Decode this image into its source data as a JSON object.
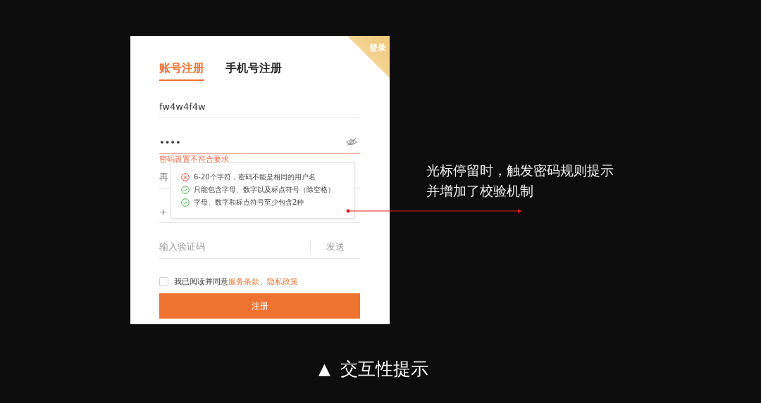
{
  "corner_tab": {
    "label": "登录"
  },
  "tabs": [
    {
      "label": "账号注册",
      "selected": true
    },
    {
      "label": "手机号注册",
      "selected": false
    }
  ],
  "fields": [
    {
      "kind": "text",
      "value": "fw4w4f4w",
      "error": false
    },
    {
      "kind": "password",
      "value": "••••",
      "error": true
    },
    {
      "kind": "covered",
      "placeholder": "再"
    },
    {
      "kind": "covered",
      "placeholder": "+"
    },
    {
      "kind": "code",
      "placeholder": "输入验证码",
      "action": "发送"
    }
  ],
  "error_message": "密码设置不符合要求",
  "password_rules": [
    {
      "text": "6-20个字符，密码不能是相同的用户名",
      "passed": false
    },
    {
      "text": "只能包含字母、数字以及标点符号（除空格）",
      "passed": true
    },
    {
      "text": "字母、数字和标点符号至少包含2种",
      "passed": true
    }
  ],
  "agreement": {
    "checked": false,
    "text": "我已阅读并同意",
    "links": [
      "服务条款",
      "隐私政策"
    ],
    "separator": "、"
  },
  "submit_button": "注册",
  "annotation": [
    "光标停留时，触发密码规则提示",
    "并增加了校验机制"
  ],
  "caption": {
    "marker": "▲",
    "text": "交互性提示"
  }
}
